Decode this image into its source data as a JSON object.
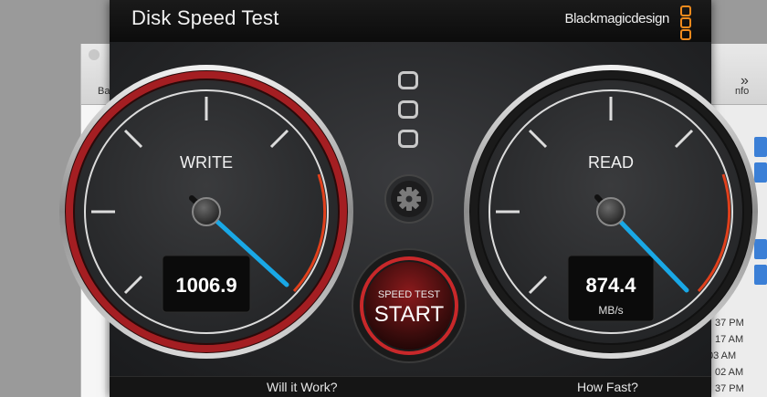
{
  "window": {
    "title": "Disk Speed Test",
    "brand": "Blackmagicdesign"
  },
  "write_gauge": {
    "label": "WRITE",
    "value": "1006.9",
    "unit": ""
  },
  "read_gauge": {
    "label": "READ",
    "value": "874.4",
    "unit": "MB/s"
  },
  "start_button": {
    "caption": "SPEED TEST",
    "label": "START"
  },
  "footer": {
    "left": "Will it Work?",
    "right": "How Fast?"
  },
  "background_window": {
    "times": [
      "37 PM",
      "17 AM",
      "03 AM",
      "02 AM",
      "37 PM"
    ],
    "toolbar_fragments": [
      "Ba",
      "nfo",
      "»"
    ]
  },
  "colors": {
    "write_ring": "#a41e22",
    "needle": "#19a8e6",
    "redzone": "#e0401c",
    "accent_orange": "#f08a1c"
  },
  "icons": [
    "gear-icon",
    "settings-squares-icon"
  ]
}
